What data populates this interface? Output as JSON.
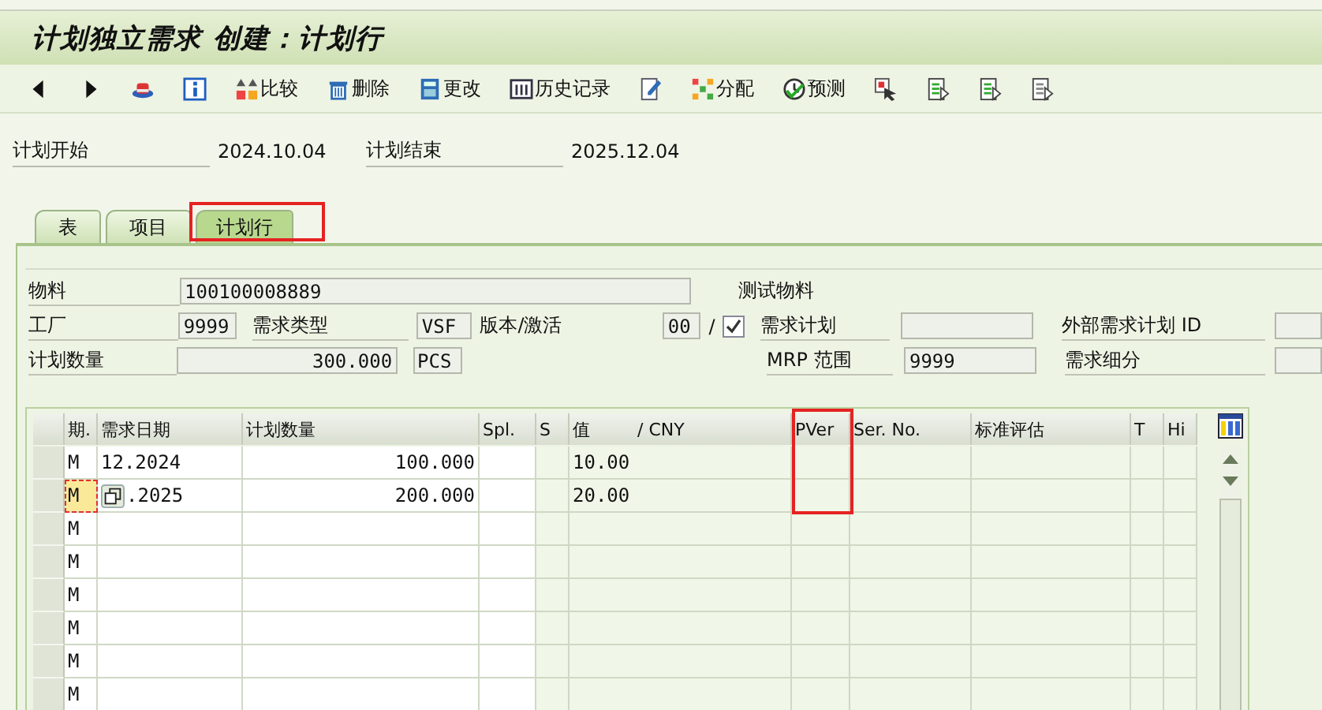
{
  "window": {
    "title": "计划独立需求 创建：计划行"
  },
  "toolbar": [
    {
      "kind": "back"
    },
    {
      "kind": "forward"
    },
    {
      "kind": "hat"
    },
    {
      "kind": "info"
    },
    {
      "kind": "compare",
      "label": "比较"
    },
    {
      "kind": "trash",
      "label": "删除"
    },
    {
      "kind": "calculator",
      "label": "更改"
    },
    {
      "kind": "columns",
      "label": "历史记录"
    },
    {
      "kind": "pencil"
    },
    {
      "kind": "network",
      "label": "分配"
    },
    {
      "kind": "clock",
      "label": "预测"
    },
    {
      "kind": "cursor"
    },
    {
      "kind": "document-arrow"
    },
    {
      "kind": "document-arrow"
    },
    {
      "kind": "document-arrow-plain"
    }
  ],
  "header_fields": [
    {
      "label": "计划开始",
      "value": "2024.10.04"
    },
    {
      "label": "计划结束",
      "value": "2025.12.04"
    }
  ],
  "tabs": [
    {
      "label": "表",
      "selected": false,
      "highlighted": false
    },
    {
      "label": "项目",
      "selected": false,
      "highlighted": false
    },
    {
      "label": "计划行",
      "selected": true,
      "highlighted": true
    }
  ],
  "material": {
    "label": "物料",
    "value": "100100008889",
    "description": "测试物料"
  },
  "plant": {
    "label": "工厂",
    "value": "9999"
  },
  "requirement_type": {
    "label": "需求类型",
    "value": "VSF"
  },
  "version": {
    "label": "版本/激活",
    "value": "00",
    "separator": "/",
    "active": true
  },
  "requirement_plan": {
    "label": "需求计划"
  },
  "external_plan_id": {
    "label": "外部需求计划 ID"
  },
  "planned_quantity": {
    "label": "计划数量",
    "value": "300.000",
    "unit": "PCS"
  },
  "mrp_area": {
    "label": "MRP 范围",
    "value": "9999"
  },
  "requirement_segment": {
    "label": "需求细分"
  },
  "table": {
    "columns": [
      {
        "label": "期.",
        "highlighted": false
      },
      {
        "label": "需求日期",
        "highlighted": false
      },
      {
        "label": "计划数量",
        "highlighted": false
      },
      {
        "label": "Spl.",
        "highlighted": false
      },
      {
        "label": "S",
        "highlighted": false
      },
      {
        "label": "值",
        "unit": "/ CNY",
        "highlighted": false
      },
      {
        "label": "PVer",
        "highlighted": true
      },
      {
        "label": "Ser. No.",
        "highlighted": false
      },
      {
        "label": "标准评估",
        "highlighted": false
      },
      {
        "label": "T",
        "highlighted": false
      },
      {
        "label": "Hi",
        "highlighted": false
      }
    ],
    "rows": [
      {
        "period": "M",
        "date": "12.2024",
        "quantity": "100.000",
        "value": "10.00",
        "focused": false
      },
      {
        "period": "M",
        "date": ".2025",
        "quantity": "200.000",
        "value": "20.00",
        "focused": true
      },
      {
        "period": "M",
        "focused": false
      },
      {
        "period": "M",
        "focused": false
      },
      {
        "period": "M",
        "focused": false
      },
      {
        "period": "M",
        "focused": false
      },
      {
        "period": "M",
        "focused": false
      },
      {
        "period": "M",
        "focused": false
      }
    ]
  }
}
